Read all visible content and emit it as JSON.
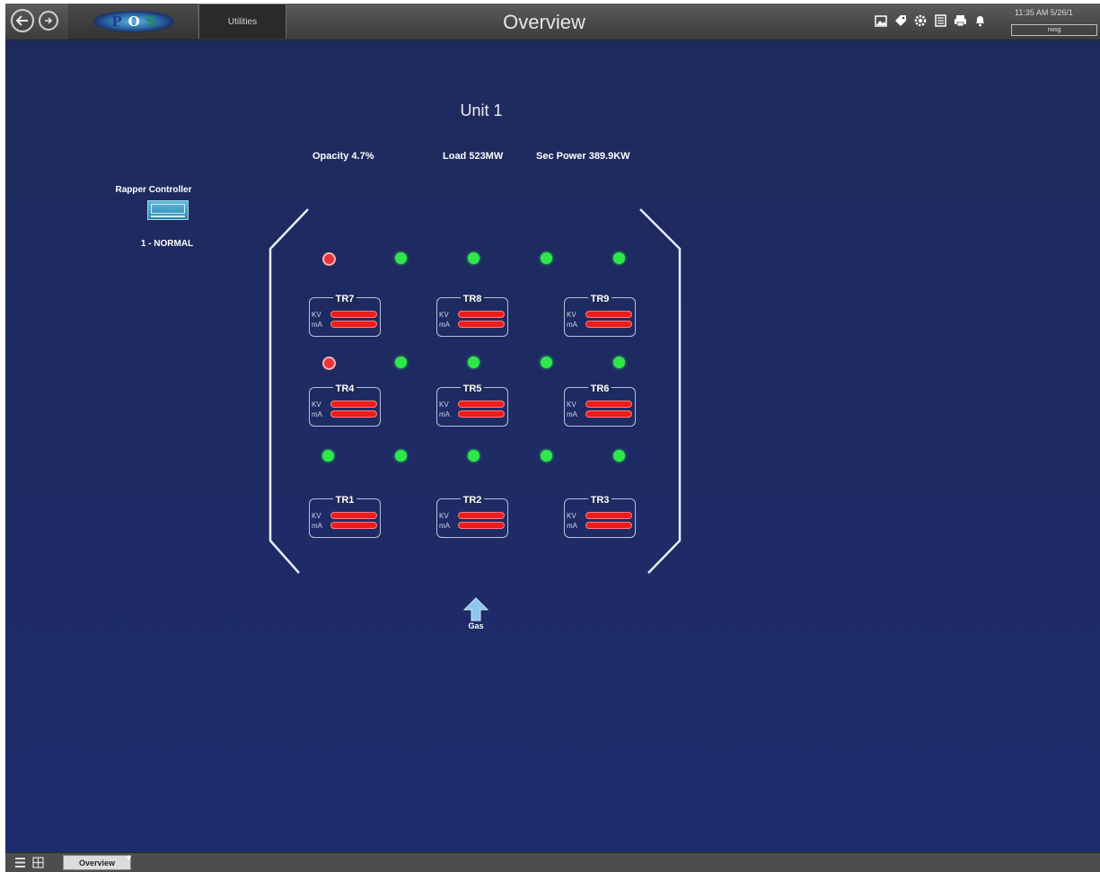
{
  "header": {
    "logo_letters": [
      "P",
      "O",
      "S"
    ],
    "utilities_tab": "Utilities",
    "title": "Overview",
    "clock": "11:35 AM 5/26/1",
    "user": "rwsg",
    "icons": [
      "picture-icon",
      "tag-icon",
      "gear-icon",
      "document-icon",
      "printer-icon",
      "bell-icon"
    ]
  },
  "main": {
    "unit_title": "Unit 1",
    "opacity": "Opacity 4.7%",
    "load": "Load 523MW",
    "sec_power": "Sec Power 389.9KW",
    "rapper_label": "Rapper Controller",
    "rapper_status": "1 - NORMAL",
    "gas_label": "Gas",
    "field_indicators": [
      [
        "red",
        "green",
        "green",
        "green",
        "green"
      ],
      [
        "red",
        "green",
        "green",
        "green",
        "green"
      ],
      [
        "green",
        "green",
        "green",
        "green",
        "green"
      ]
    ],
    "transformers": [
      {
        "name": "TR7",
        "kv_label": "KV",
        "ma_label": "mA"
      },
      {
        "name": "TR8",
        "kv_label": "KV",
        "ma_label": "mA"
      },
      {
        "name": "TR9",
        "kv_label": "KV",
        "ma_label": "mA"
      },
      {
        "name": "TR4",
        "kv_label": "KV",
        "ma_label": "mA"
      },
      {
        "name": "TR5",
        "kv_label": "KV",
        "ma_label": "mA"
      },
      {
        "name": "TR6",
        "kv_label": "KV",
        "ma_label": "mA"
      },
      {
        "name": "TR1",
        "kv_label": "KV",
        "ma_label": "mA"
      },
      {
        "name": "TR2",
        "kv_label": "KV",
        "ma_label": "mA"
      },
      {
        "name": "TR3",
        "kv_label": "KV",
        "ma_label": "mA"
      }
    ]
  },
  "footer": {
    "tab": "Overview"
  },
  "colors": {
    "background": "#1f2a5c",
    "status_ok": "#2ee84a",
    "status_alarm": "#e8333c",
    "bar_fill": "#ee1c1c"
  }
}
